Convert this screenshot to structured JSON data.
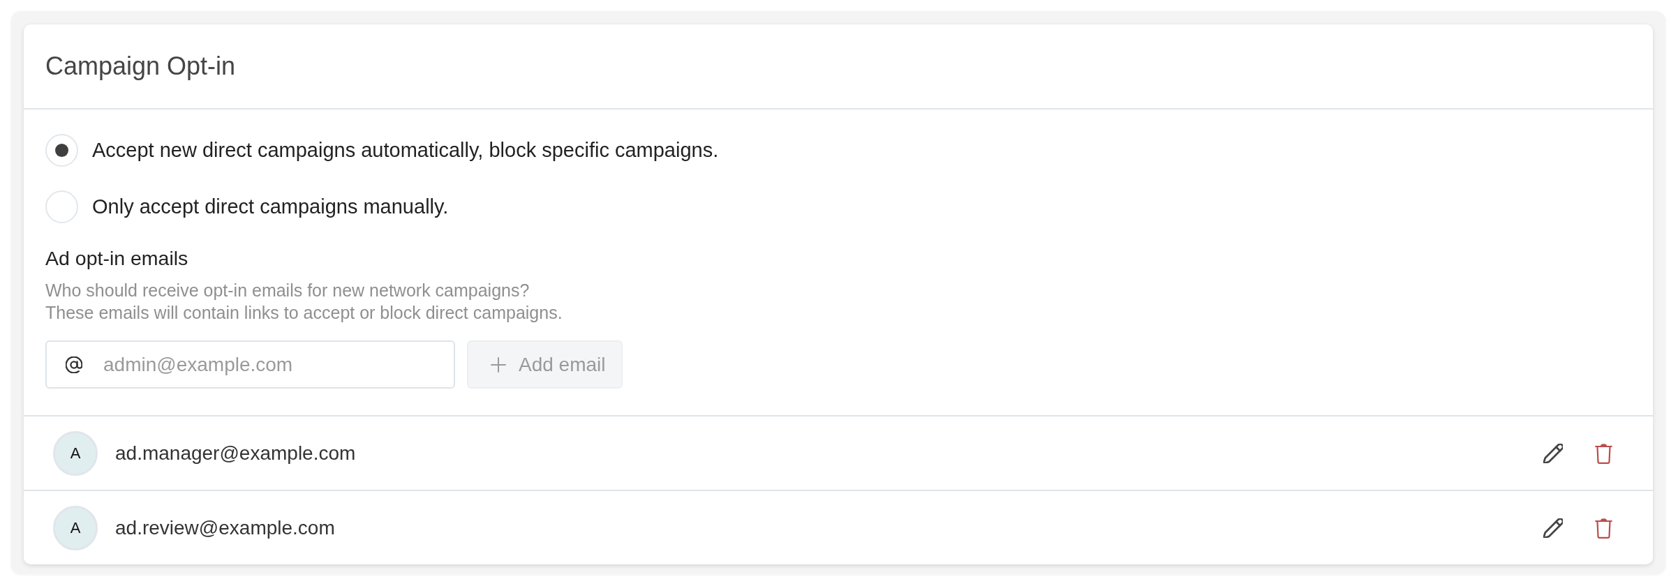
{
  "card": {
    "title": "Campaign Opt-in"
  },
  "options": [
    {
      "label": "Accept new direct campaigns automatically, block specific campaigns.",
      "selected": true
    },
    {
      "label": "Only accept direct campaigns manually.",
      "selected": false
    }
  ],
  "emails_section": {
    "heading": "Ad opt-in emails",
    "help": [
      "Who should receive opt-in emails for new network campaigns?",
      "These emails will contain links to accept or block direct campaigns."
    ],
    "input": {
      "placeholder": "admin@example.com"
    },
    "add_button": {
      "label": "Add email",
      "disabled": true
    }
  },
  "recipients": [
    {
      "avatar": "A",
      "email": "ad.manager@example.com"
    },
    {
      "avatar": "A",
      "email": "ad.review@example.com"
    }
  ]
}
